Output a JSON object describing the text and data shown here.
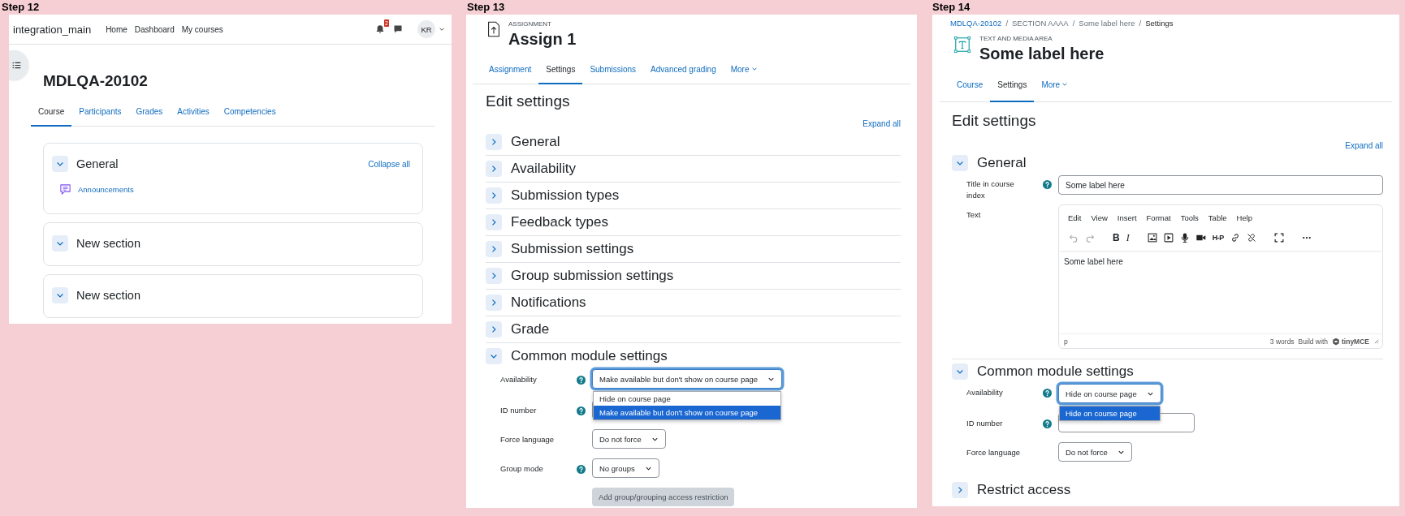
{
  "course_page": {
    "step_label": "Step 12",
    "navbar": {
      "brand": "integration_main",
      "links": [
        "Home",
        "Dashboard",
        "My courses"
      ],
      "notification_badge": "2",
      "avatar": "KR"
    },
    "title": "MDLQA-20102",
    "tabs": [
      {
        "label": "Course",
        "selected": true
      },
      {
        "label": "Participants",
        "selected": false
      },
      {
        "label": "Grades",
        "selected": false
      },
      {
        "label": "Activities",
        "selected": false
      },
      {
        "label": "Competencies",
        "selected": false
      }
    ],
    "collapse_link": "Collapse all",
    "sections": [
      {
        "title": "General",
        "expanded": true,
        "activities": [
          "Announcements"
        ]
      },
      {
        "title": "New section",
        "expanded": true
      },
      {
        "title": "New section",
        "expanded": true
      }
    ]
  },
  "assignment_page": {
    "step_label": "Step 13",
    "eyebrow": "ASSIGNMENT",
    "title": "Assign 1",
    "tabs": [
      {
        "label": "Assignment",
        "selected": false,
        "menu": false
      },
      {
        "label": "Settings",
        "selected": true,
        "menu": false
      },
      {
        "label": "Submissions",
        "selected": false,
        "menu": false
      },
      {
        "label": "Advanced grading",
        "selected": false,
        "menu": false
      },
      {
        "label": "More",
        "selected": false,
        "menu": true
      }
    ],
    "heading": "Edit settings",
    "expand_link": "Expand all",
    "sections": [
      {
        "title": "General",
        "expanded": false
      },
      {
        "title": "Availability",
        "expanded": false
      },
      {
        "title": "Submission types",
        "expanded": false
      },
      {
        "title": "Feedback types",
        "expanded": false
      },
      {
        "title": "Submission settings",
        "expanded": false
      },
      {
        "title": "Group submission settings",
        "expanded": false
      },
      {
        "title": "Notifications",
        "expanded": false
      },
      {
        "title": "Grade",
        "expanded": false
      },
      {
        "title": "Common module settings",
        "expanded": true,
        "fields": [
          {
            "kind": "select",
            "label": "Availability",
            "help": true,
            "value": "Make available but don't show on course page",
            "open": true,
            "options": [
              {
                "label": "Hide on course page",
                "selected": false
              },
              {
                "label": "Make available but don't show on course page",
                "selected": true
              }
            ]
          },
          {
            "kind": "text",
            "label": "ID number",
            "help": true
          },
          {
            "kind": "select",
            "label": "Force language",
            "help": false,
            "value": "Do not force",
            "open": false
          },
          {
            "kind": "select",
            "label": "Group mode",
            "help": true,
            "value": "No groups",
            "open": false
          },
          {
            "kind": "button",
            "label": "Add group/grouping access restriction",
            "help": false,
            "disabled": true
          }
        ]
      }
    ]
  },
  "label_page": {
    "step_label": "Step 14",
    "breadcrumb": {
      "separator": "/",
      "items": [
        {
          "label": "MDLQA-20102",
          "link": true,
          "current": false
        },
        {
          "label": "SECTION AAAA",
          "link": false,
          "current": false
        },
        {
          "label": "Some label here",
          "link": false,
          "current": false
        },
        {
          "label": "Settings",
          "link": false,
          "current": true
        }
      ]
    },
    "eyebrow": "TEXT AND MEDIA AREA",
    "title": "Some label here",
    "tabs": [
      {
        "label": "Course",
        "selected": false,
        "menu": false
      },
      {
        "label": "Settings",
        "selected": true,
        "menu": false
      },
      {
        "label": "More",
        "selected": false,
        "menu": true
      }
    ],
    "heading": "Edit settings",
    "expand_link": "Expand all",
    "sections": [
      {
        "title": "General",
        "expanded": true,
        "fields": [
          {
            "kind": "text",
            "label": "Title in course index",
            "help": true,
            "value": "Some label here"
          },
          {
            "kind": "editor",
            "label": "Text",
            "help": false,
            "menu": [
              "Edit",
              "View",
              "Insert",
              "Format",
              "Tools",
              "Table",
              "Help"
            ],
            "toolbar": {
              "bold": "B",
              "italic": "I",
              "h5p": "H-P"
            },
            "content": "Some label here",
            "path": "p",
            "word_count": "3 words",
            "branding": "Build with",
            "brand_name": "tinyMCE"
          }
        ]
      },
      {
        "title": "Common module settings",
        "expanded": true,
        "fields": [
          {
            "kind": "select",
            "label": "Availability",
            "help": true,
            "value": "Hide on course page",
            "open": true,
            "options": [
              {
                "label": "Hide on course page",
                "selected": true
              }
            ]
          },
          {
            "kind": "text",
            "label": "ID number",
            "help": true
          },
          {
            "kind": "select",
            "label": "Force language",
            "help": false,
            "value": "Do not force",
            "open": false
          }
        ]
      },
      {
        "title": "Restrict access",
        "expanded": false
      }
    ]
  }
}
